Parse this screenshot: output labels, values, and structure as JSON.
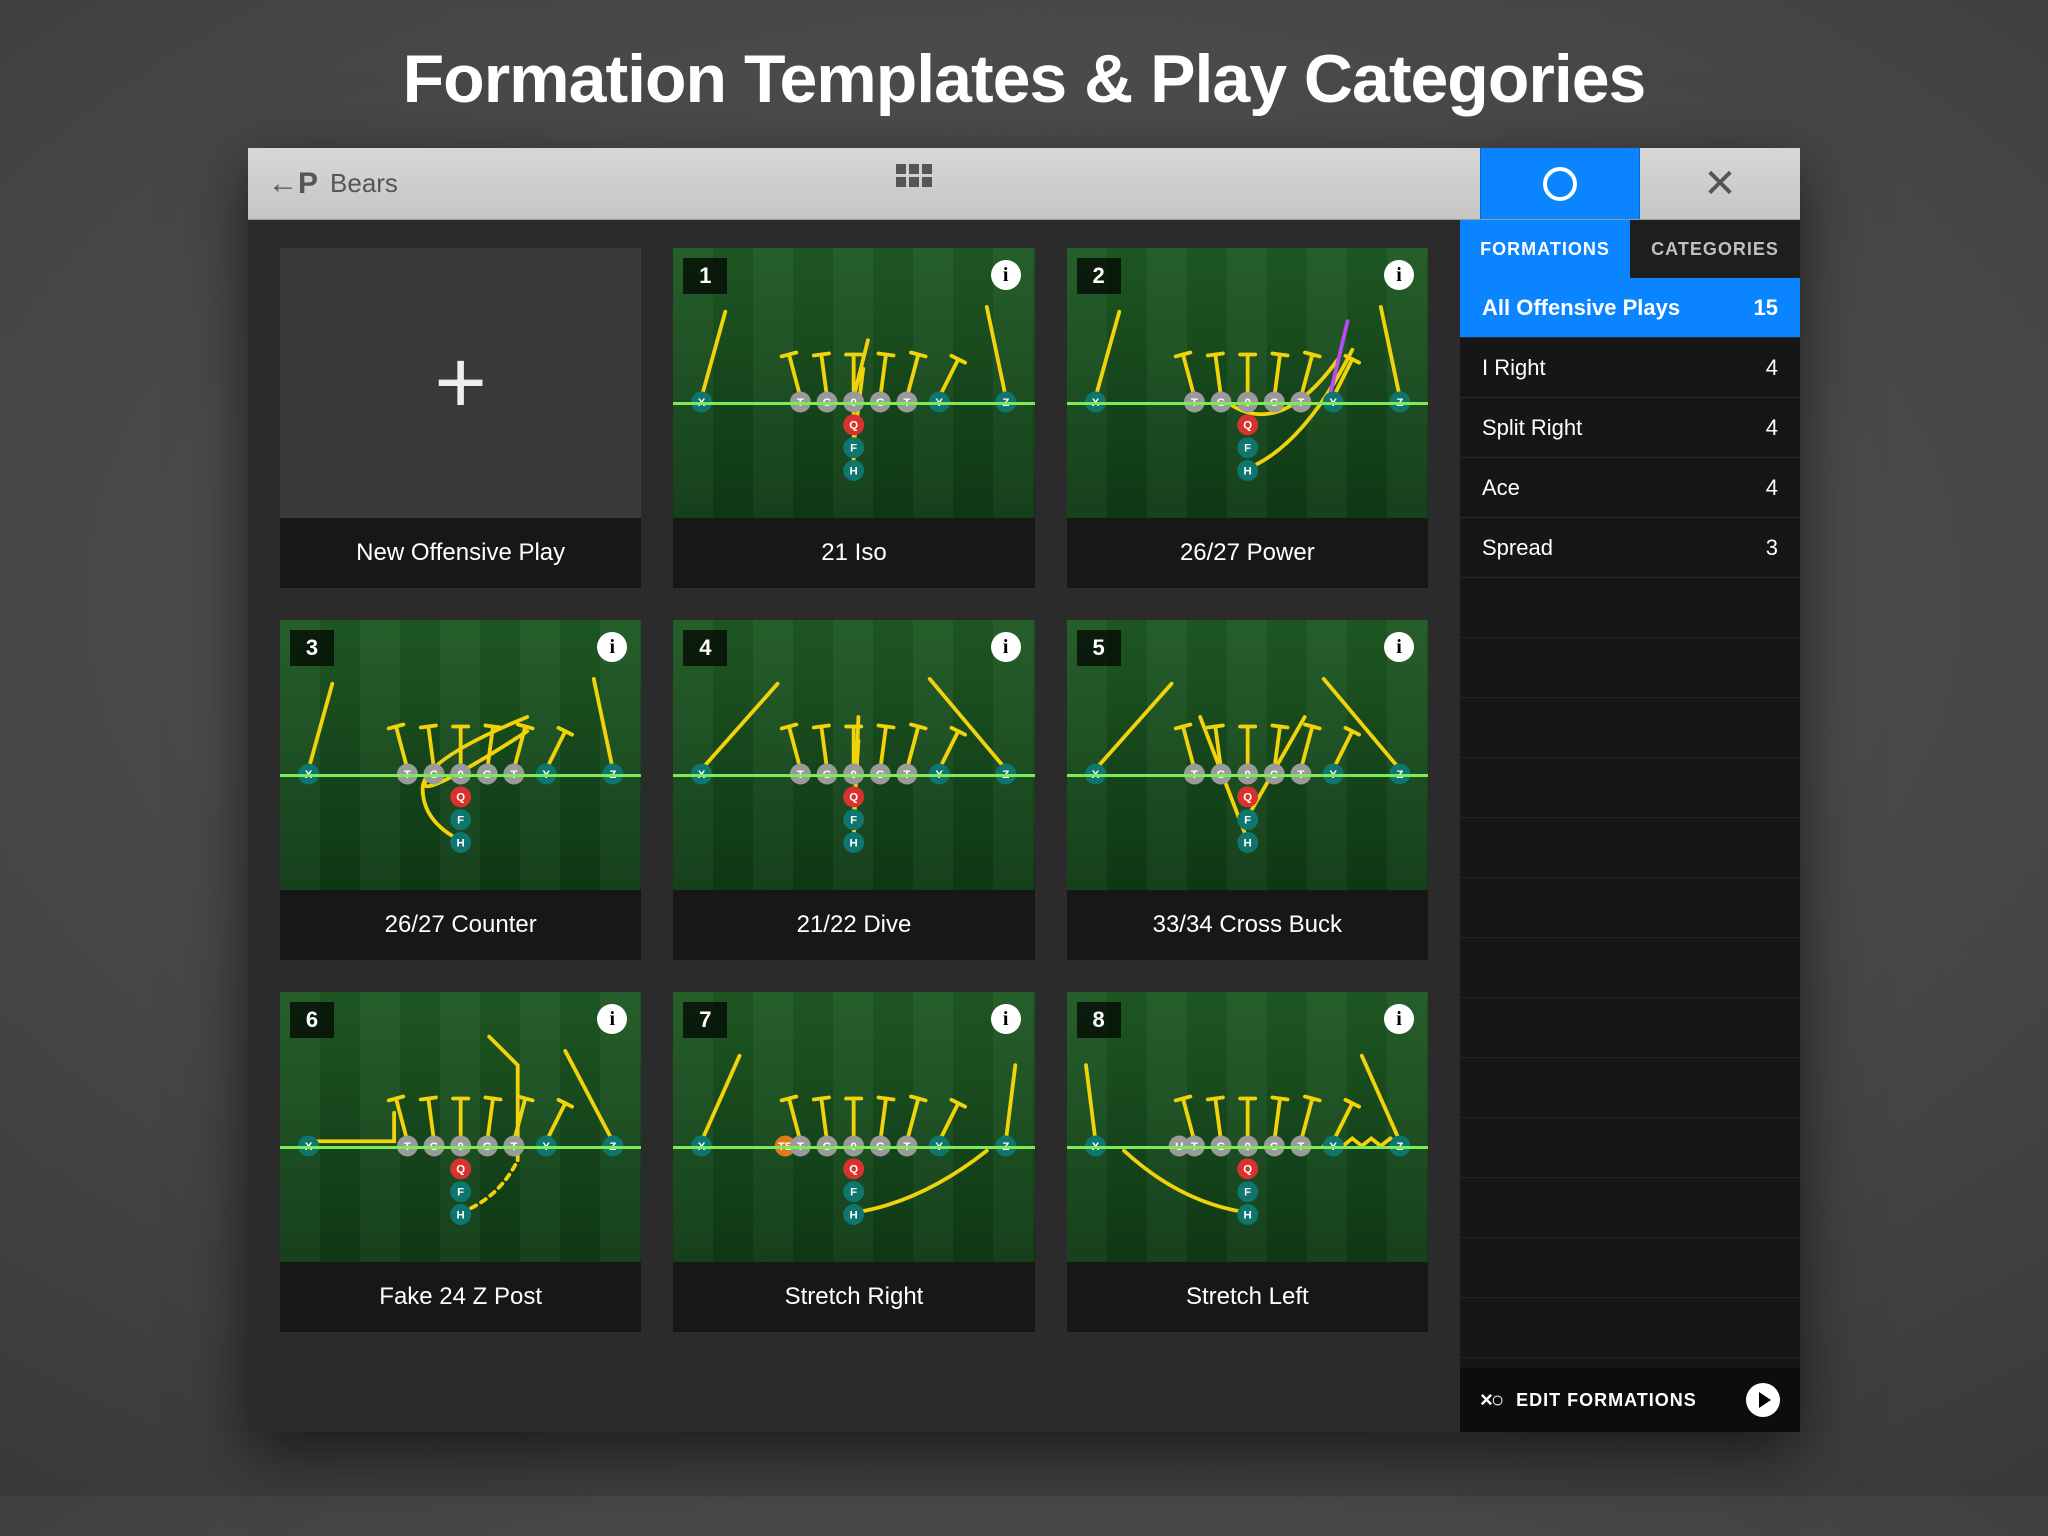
{
  "page_title": "Formation Templates & Play Categories",
  "toolbar": {
    "back_prefix": "←P",
    "team_name": "Bears"
  },
  "sidebar": {
    "tab_formations": "FORMATIONS",
    "tab_categories": "CATEGORIES",
    "items": [
      {
        "label": "All Offensive Plays",
        "count": "15",
        "active": true
      },
      {
        "label": "I Right",
        "count": "4"
      },
      {
        "label": "Split Right",
        "count": "4"
      },
      {
        "label": "Ace",
        "count": "4"
      },
      {
        "label": "Spread",
        "count": "3"
      }
    ],
    "footer_label": "EDIT FORMATIONS",
    "xo": "×○"
  },
  "new_card_label": "New Offensive Play",
  "plays": [
    {
      "num": "1",
      "name": "21 Iso"
    },
    {
      "num": "2",
      "name": "26/27 Power"
    },
    {
      "num": "3",
      "name": "26/27 Counter"
    },
    {
      "num": "4",
      "name": "21/22 Dive"
    },
    {
      "num": "5",
      "name": "33/34 Cross Buck"
    },
    {
      "num": "6",
      "name": "Fake 24 Z Post"
    },
    {
      "num": "7",
      "name": "Stretch Right"
    },
    {
      "num": "8",
      "name": "Stretch Left"
    }
  ],
  "positions": {
    "offense_center": [
      "T",
      "G",
      "0",
      "G",
      "T"
    ],
    "qb": "Q",
    "fb": "F",
    "hb": "H",
    "x": "X",
    "y": "Y",
    "z": "Z",
    "te": "TE",
    "u": "U"
  },
  "colors": {
    "accent": "#0a84ff",
    "route": "#f2d20a",
    "qb": "#d8322f",
    "skill": "#0e766f",
    "line": "#9a9a9a",
    "special": "#e07b1a",
    "motion": "#b84cf0"
  }
}
